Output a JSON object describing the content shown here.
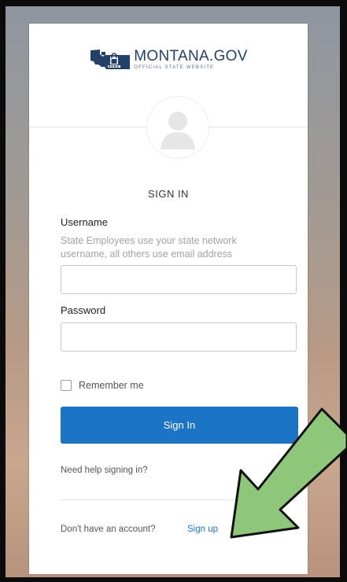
{
  "logo": {
    "title": "MONTANA.GOV",
    "subtitle": "OFFICIAL STATE WEBSITE",
    "icon": "montana-map-lock-icon"
  },
  "form": {
    "title": "SIGN IN",
    "username_label": "Username",
    "username_hint": "State Employees use your state network username, all others use email address",
    "username_value": "",
    "password_label": "Password",
    "password_value": "",
    "remember_label": "Remember me",
    "remember_checked": false,
    "submit_label": "Sign In",
    "help_link": "Need help signing in?",
    "no_account_text": "Don't have an account?",
    "signup_link": "Sign up"
  },
  "colors": {
    "primary": "#1b74c5",
    "arrow_fill": "#8fc77a",
    "arrow_stroke": "#111111"
  },
  "annotation": {
    "icon": "green-arrow-icon"
  }
}
